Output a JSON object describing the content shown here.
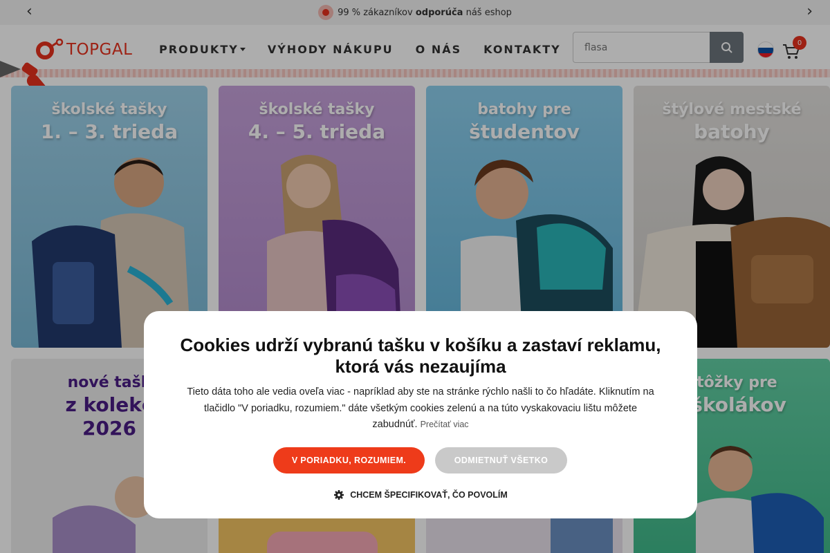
{
  "announcement": {
    "prefix": "99 % zákazníkov",
    "strong": "odporúča",
    "suffix": "náš eshop",
    "prev": "‹",
    "next": "›"
  },
  "header": {
    "logo_text": "TOPGAL",
    "nav": [
      {
        "label": "PRODUKTY",
        "has_dropdown": true
      },
      {
        "label": "VÝHODY NÁKUPU",
        "has_dropdown": false
      },
      {
        "label": "O NÁS",
        "has_dropdown": false
      },
      {
        "label": "KONTAKTY",
        "has_dropdown": false
      }
    ],
    "search_placeholder": "flasa",
    "language": "SK",
    "cart_count": "0"
  },
  "tiles": [
    {
      "line1": "školské tašky",
      "line2": "1. – 3. trieda",
      "color": "#8fc8e3"
    },
    {
      "line1": "školské tašky",
      "line2": "4. – 5. trieda",
      "color": "#c29ad6"
    },
    {
      "line1": "batohy pre",
      "line2": "študentov",
      "color": "#7dc5e8"
    },
    {
      "line1": "štýlové mestské",
      "line2": "batohy",
      "color": "#d9d7d4"
    },
    {
      "line1": "nové tašk",
      "line2": "z kolekc",
      "line3": "2026",
      "color": "#ededed"
    },
    {
      "line1": "",
      "line2": "",
      "color": "#f1c86b"
    },
    {
      "line1": "",
      "line2": "",
      "color": "#e7e0ea"
    },
    {
      "line1": "atôžky pre",
      "line2": "dškolákov",
      "color": "#59c79b"
    }
  ],
  "cookie": {
    "title": "Cookies udrží vybranú tašku v košíku a zastaví reklamu, ktorá vás nezaujíma",
    "body": "Tieto dáta toho ale vedia oveľa viac - napríklad aby ste na stránke rýchlo našli to čo hľadáte. Kliknutím na tlačidlo \"V poriadku, rozumiem.\" dáte všetkým cookies zelenú a na túto vyskakovaciu lištu môžete zabudnúť.",
    "read_more": "Prečítať viac",
    "accept": "V PORIADKU, ROZUMIEM.",
    "reject": "ODMIETNUŤ VŠETKO",
    "specify": "CHCEM ŠPECIFIKOVAŤ, ČO POVOLÍM"
  },
  "colors": {
    "brand": "#e8321e",
    "accept_button": "#ee3b1a",
    "reject_button": "#c9c9c9"
  }
}
